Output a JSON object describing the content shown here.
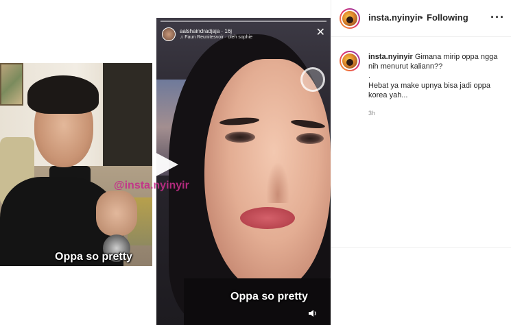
{
  "post": {
    "username": "insta.nyinyir",
    "dot": "•",
    "follow_status": "Following",
    "more_icon": "more-options-icon"
  },
  "caption_comment": {
    "username": "insta.nyinyir",
    "line1": "Gimana mirip oppa ngga nih menurut kaliann??",
    "line2": ".",
    "line3": "Hebat ya make upnya bisa jadi oppa korea yah...",
    "timestamp": "3h"
  },
  "media": {
    "left_caption": "Oppa so pretty",
    "right_caption": "Oppa so pretty",
    "watermark": "@insta.nyinyir",
    "story_user": "aalshaindradjaja · 16j",
    "story_sub": "♫ Faun Reunitesvoir · oleh sophie",
    "close_icon": "✕"
  },
  "colors": {
    "watermark": "#c52d8a",
    "avatar_ring_start": "#f9a81a",
    "avatar_ring_end": "#833ab4",
    "timestamp": "#8e8e8e"
  }
}
